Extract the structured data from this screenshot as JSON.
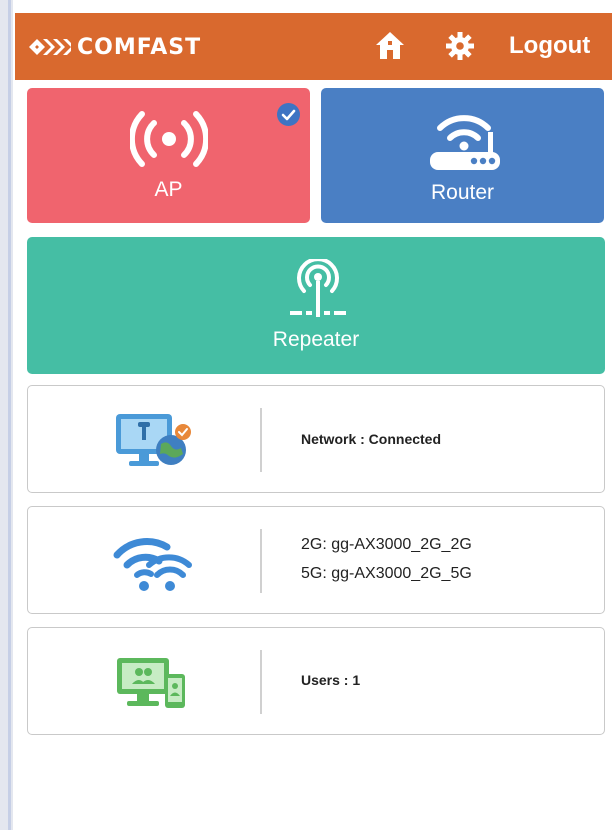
{
  "header": {
    "brand": "COMFAST",
    "logout_label": "Logout",
    "background_color": "#d9692e",
    "icons": [
      "comfast-logo-icon",
      "home-icon",
      "gear-icon"
    ]
  },
  "modes": {
    "ap": {
      "label": "AP",
      "selected": true,
      "color": "#f0646e",
      "icon": "broadcast-icon"
    },
    "router": {
      "label": "Router",
      "selected": false,
      "color": "#4a7fc4",
      "icon": "router-icon"
    },
    "repeater": {
      "label": "Repeater",
      "selected": false,
      "color": "#45bea4",
      "icon": "antenna-icon"
    }
  },
  "status": {
    "network": {
      "text": "Network : Connected",
      "icon": "network-globe-icon"
    },
    "wifi": {
      "line_2g": "2G: gg-AX3000_2G_2G",
      "line_5g": "5G: gg-AX3000_2G_5G",
      "icon": "wifi-icon"
    },
    "users": {
      "text": "Users : 1",
      "icon": "users-devices-icon"
    }
  }
}
